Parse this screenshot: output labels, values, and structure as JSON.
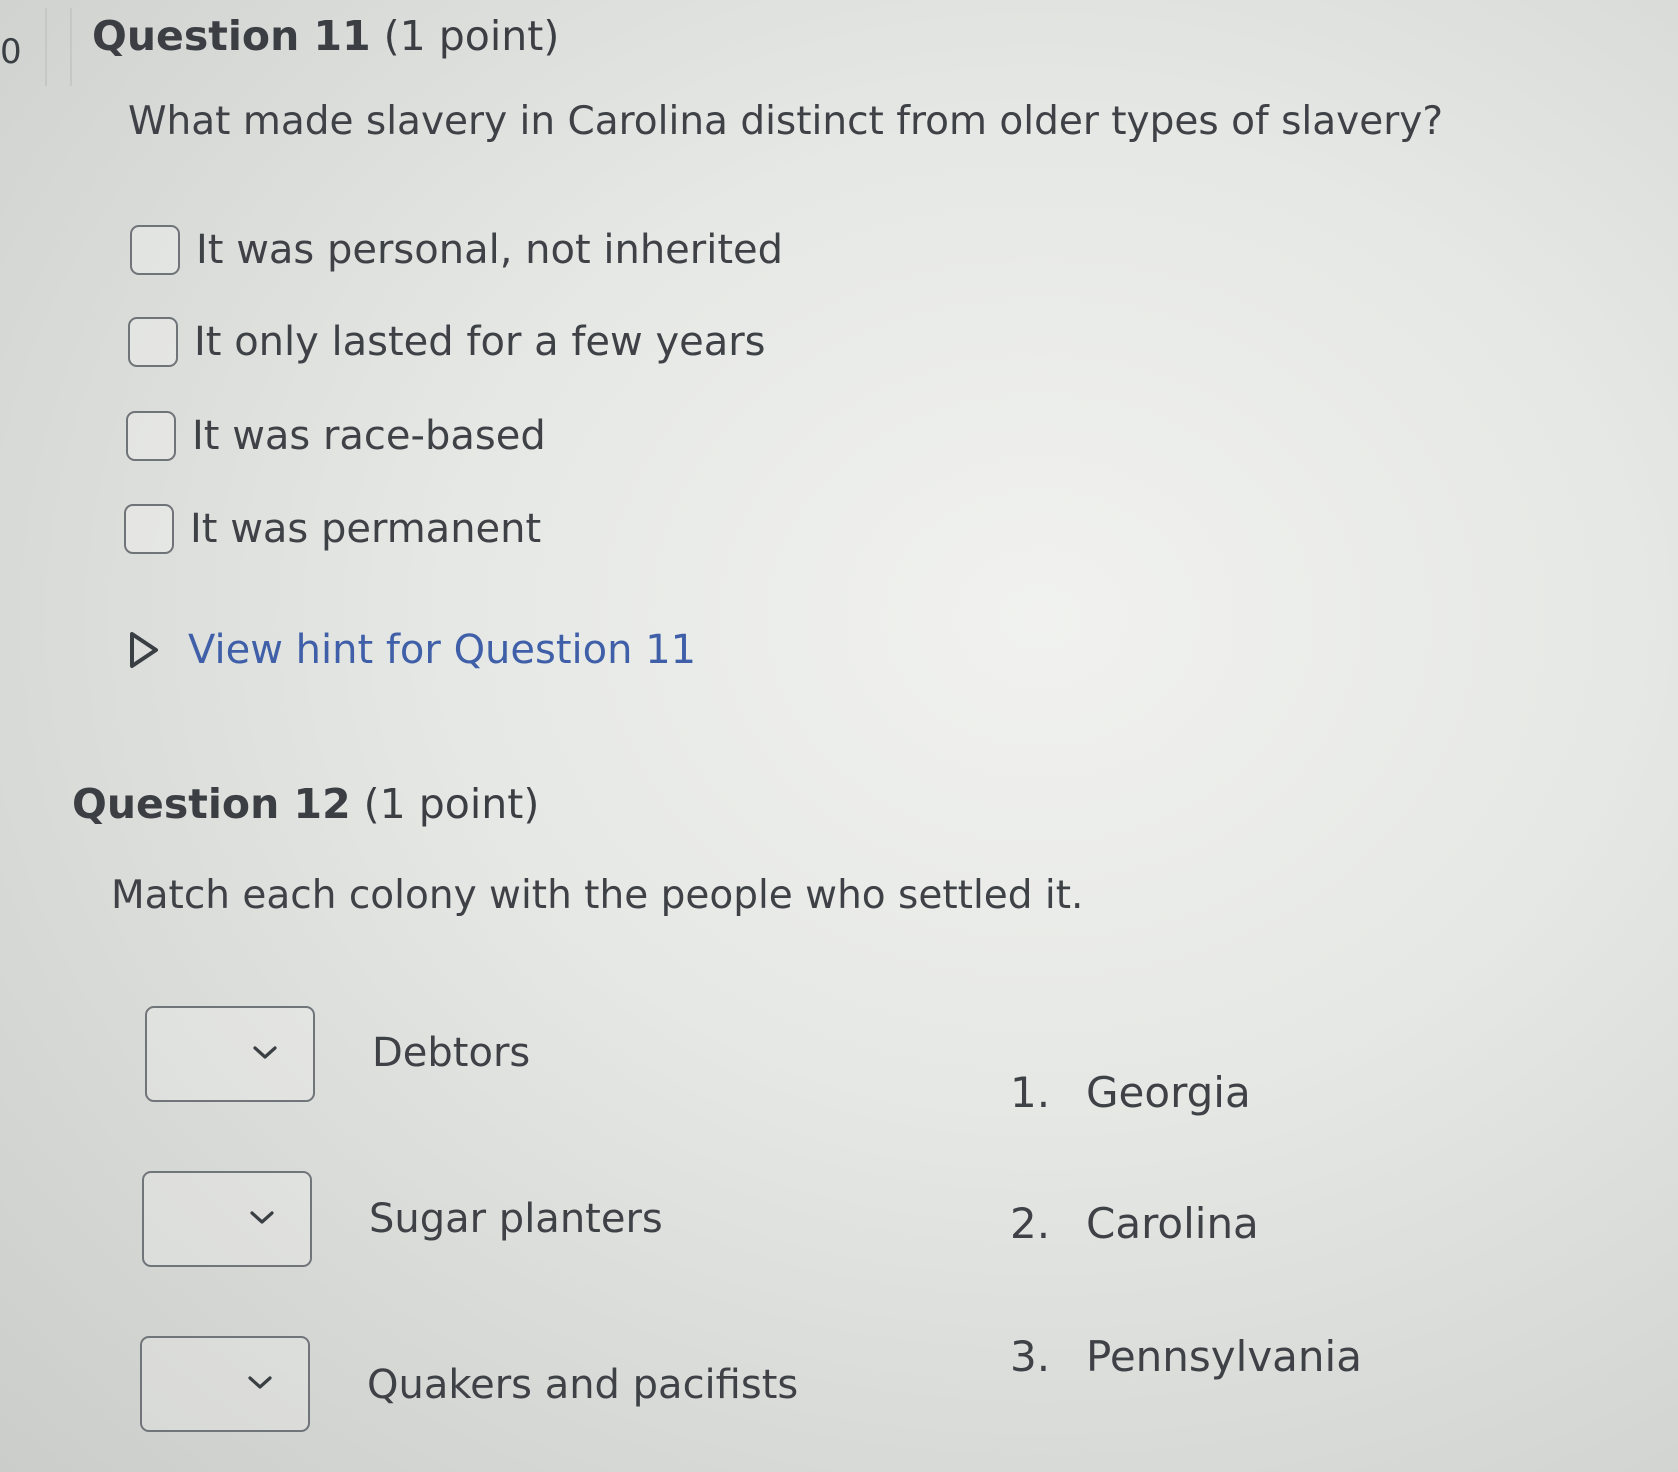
{
  "edge_number": "0",
  "question11": {
    "title": "Question 11",
    "points": "(1 point)",
    "prompt": "What made slavery in Carolina distinct from older types of slavery?",
    "options": [
      "It was personal, not inherited",
      "It only lasted for a few years",
      "It was race-based",
      "It was permanent"
    ],
    "hint": "View hint for Question 11"
  },
  "question12": {
    "title": "Question 12",
    "points": "(1 point)",
    "prompt": "Match each colony with the people who settled it.",
    "matches": [
      {
        "label": "Debtors",
        "selected": ""
      },
      {
        "label": "Sugar planters",
        "selected": ""
      },
      {
        "label": "Quakers and pacifists",
        "selected": ""
      }
    ],
    "choices": [
      {
        "num": "1.",
        "name": "Georgia"
      },
      {
        "num": "2.",
        "name": "Carolina"
      },
      {
        "num": "3.",
        "name": "Pennsylvania"
      }
    ]
  },
  "colors": {
    "link": "#3f5fa8",
    "text": "#3e4247",
    "border": "#70757a"
  },
  "icons": {
    "hint_toggle": "triangle-right-icon",
    "select_arrow": "chevron-down-icon"
  }
}
